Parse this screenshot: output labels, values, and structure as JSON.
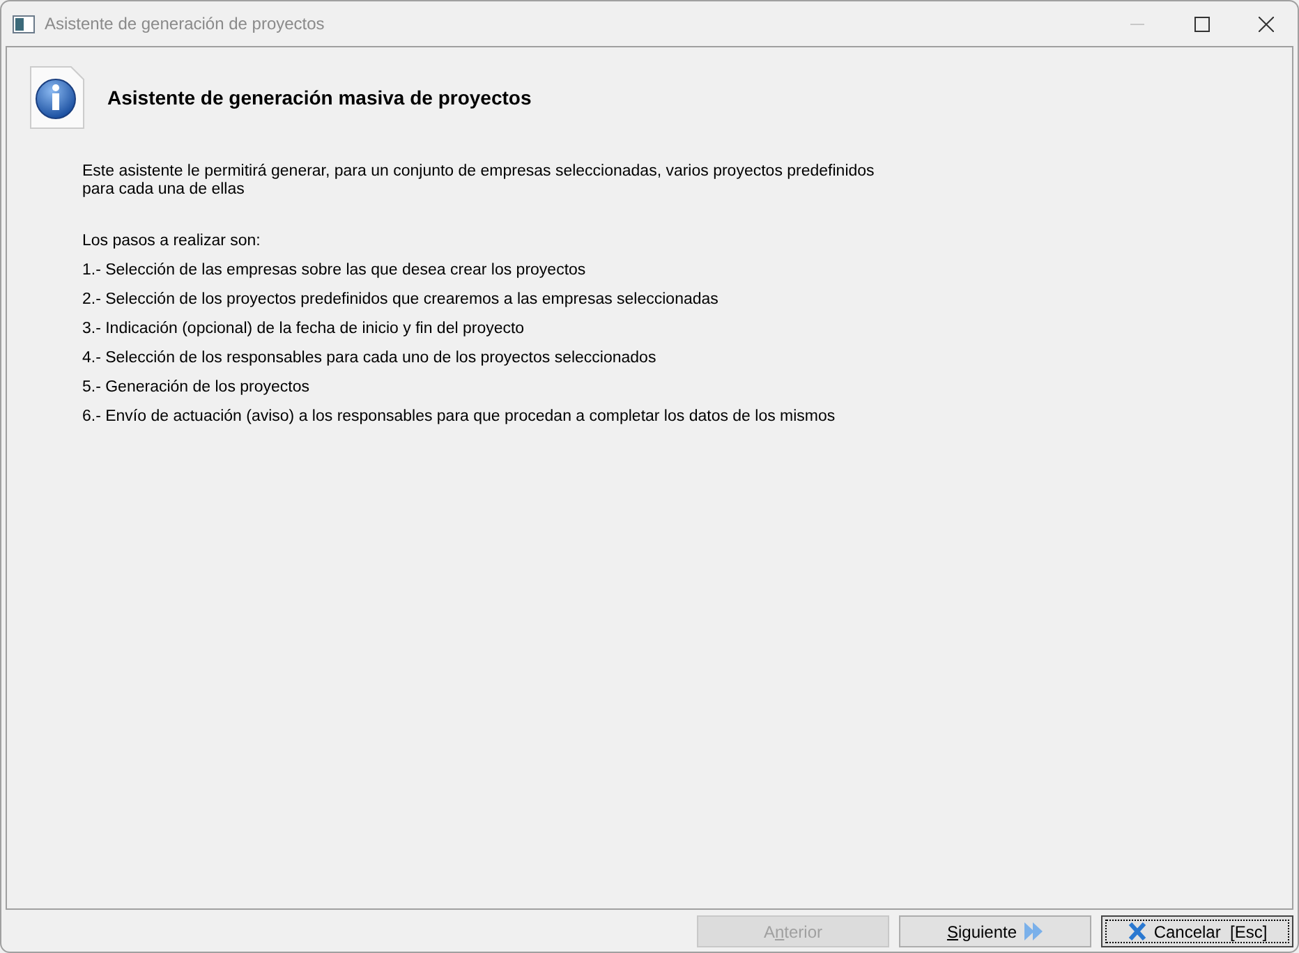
{
  "window": {
    "title": "Asistente de generación de proyectos"
  },
  "header": {
    "title": "Asistente de generación masiva de proyectos"
  },
  "intro": "Este asistente le permitirá generar, para un conjunto de empresas seleccionadas, varios proyectos predefinidos\npara cada una de ellas",
  "steps_heading": "Los pasos a realizar son:",
  "steps": [
    "1.- Selección de las empresas sobre las que desea crear los proyectos",
    "2.- Selección de los proyectos predefinidos que crearemos a las empresas seleccionadas",
    "3.- Indicación (opcional) de la fecha de inicio y fin del proyecto",
    "4.- Selección de los responsables para cada uno de los proyectos seleccionados",
    "5.- Generación de los proyectos",
    "6.- Envío de actuación (aviso) a los responsables para que procedan a completar los datos de los mismos"
  ],
  "buttons": [
    {
      "kind": "back",
      "label_start": "A",
      "access_key": "n",
      "label_end": "terior",
      "disabled": true,
      "focused": false
    },
    {
      "kind": "next",
      "access_key": "S",
      "label_end": "iguiente",
      "disabled": false,
      "focused": false
    },
    {
      "kind": "cancel",
      "label": "Cancelar  [Esc]",
      "disabled": false,
      "focused": true
    }
  ]
}
